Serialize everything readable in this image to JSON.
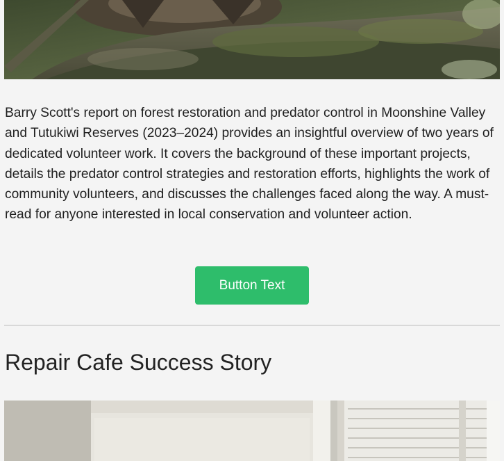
{
  "article": {
    "image_alt": "Bird perched on a moss-covered tree branch",
    "description": "Barry Scott's report on forest restoration and predator control in Moonshine Valley and Tutukiwi Reserves (2023–2024) provides an insightful overview of two years of dedicated volunteer work. It covers the background of these important projects, details the predator control strategies and restoration efforts, highlights the work of community volunteers, and discusses the challenges faced along the way. A must-read for anyone interested in local conservation and volunteer action.",
    "button_label": "Button Text"
  },
  "next_section": {
    "heading": "Repair Cafe Success Story",
    "image_alt": "Interior with light-colored walls and window blinds"
  },
  "colors": {
    "page_background": "#f4f4f4",
    "button_background": "#2ebd6b",
    "button_text": "#ffffff",
    "divider": "#d8d8d8"
  }
}
